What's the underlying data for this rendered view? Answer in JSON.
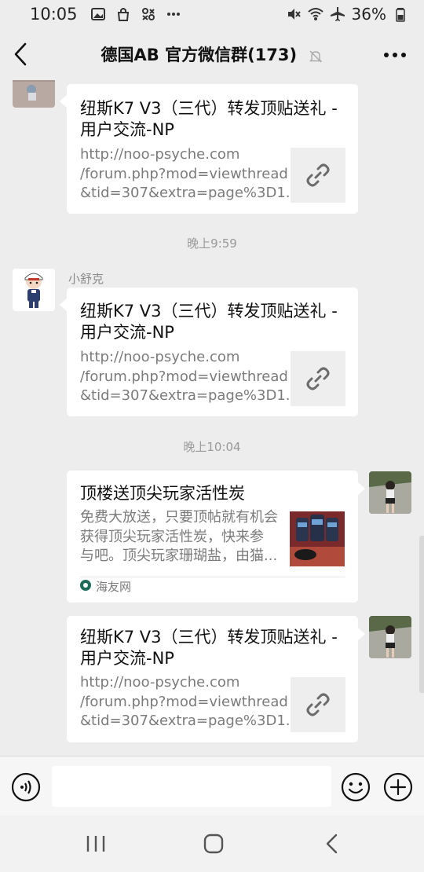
{
  "status": {
    "time": "10:05",
    "battery": "36%"
  },
  "header": {
    "title": "德国AB  官方微信群(173)"
  },
  "messages": [
    {
      "title_line1": "纽斯K7 V3（三代）转发顶贴送礼 -",
      "title_line2": "用户交流-NP",
      "desc_line1": "http://noo-psyche.com",
      "desc_line2": "/forum.php?mod=viewthread",
      "desc_line3": "&tid=307&extra=page%3D1..."
    },
    {
      "timestamp": "晚上9:59",
      "sender": "小舒克",
      "title_line1": "纽斯K7 V3（三代）转发顶贴送礼 -",
      "title_line2": "用户交流-NP",
      "desc_line1": "http://noo-psyche.com",
      "desc_line2": "/forum.php?mod=viewthread",
      "desc_line3": "&tid=307&extra=page%3D1..."
    },
    {
      "timestamp": "晚上10:04",
      "title_line1": "顶楼送顶尖玩家活性炭",
      "desc_line1": "免费大放送，只要顶帖就有机会",
      "desc_line2": "获得顶尖玩家活性炭，快来参",
      "desc_line3": "与吧。顶尖玩家珊瑚盐，由猫...",
      "source": "海友网"
    },
    {
      "title_line1": "纽斯K7 V3（三代）转发顶贴送礼 -",
      "title_line2": "用户交流-NP",
      "desc_line1": "http://noo-psyche.com",
      "desc_line2": "/forum.php?mod=viewthread",
      "desc_line3": "&tid=307&extra=page%3D1..."
    }
  ],
  "icons": {
    "back": "chevron-left-icon",
    "more": "more-dots-icon",
    "mute": "bell-off-icon",
    "link": "link-icon",
    "voice": "voice-icon",
    "emoji": "emoji-icon",
    "add": "plus-circle-icon"
  },
  "colors": {
    "background": "#ededed",
    "card": "#ffffff",
    "muted_text": "#7b7b7b"
  }
}
